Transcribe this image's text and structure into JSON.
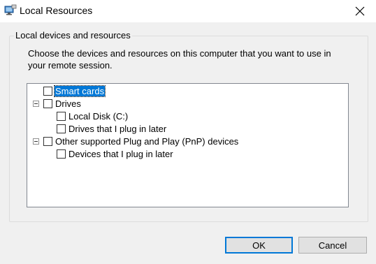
{
  "window": {
    "title": "Local Resources",
    "icon": "remote-desktop-icon",
    "close_icon": "close-icon"
  },
  "group": {
    "label": "Local devices and resources",
    "description": "Choose the devices and resources on this computer that you want to use in your remote session."
  },
  "tree": {
    "items": [
      {
        "label": "Smart cards",
        "checked": false,
        "selected": true,
        "expander": null
      },
      {
        "label": "Drives",
        "checked": false,
        "selected": false,
        "expander": "expanded"
      },
      {
        "label": "Local Disk (C:)",
        "checked": false,
        "selected": false,
        "expander": null
      },
      {
        "label": "Drives that I plug in later",
        "checked": false,
        "selected": false,
        "expander": null
      },
      {
        "label": "Other supported Plug and Play (PnP) devices",
        "checked": false,
        "selected": false,
        "expander": "expanded"
      },
      {
        "label": "Devices that I plug in later",
        "checked": false,
        "selected": false,
        "expander": null
      }
    ]
  },
  "buttons": {
    "ok": "OK",
    "cancel": "Cancel"
  },
  "colors": {
    "accent": "#0078d7",
    "window_bg": "#f0f0f0",
    "titlebar_bg": "#ffffff"
  }
}
